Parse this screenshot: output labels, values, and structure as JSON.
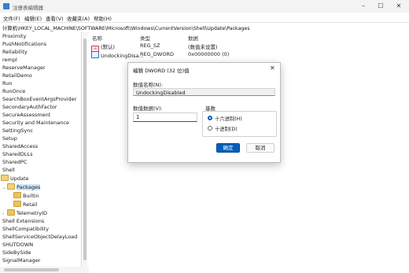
{
  "window": {
    "title": "注册表编辑器",
    "minimize_glyph": "–",
    "maximize_glyph": "☐",
    "close_glyph": "✕"
  },
  "menu": [
    "文件(F)",
    "编辑(E)",
    "查看(V)",
    "收藏夹(A)",
    "帮助(H)"
  ],
  "address": "计算机\\HKEY_LOCAL_MACHINE\\SOFTWARE\\Microsoft\\Windows\\CurrentVersion\\Shell\\Update\\Packages",
  "tree": {
    "items": [
      {
        "label": "Proximity"
      },
      {
        "label": "PushNotifications"
      },
      {
        "label": "Reliability"
      },
      {
        "label": "rempl"
      },
      {
        "label": "ReserveManager"
      },
      {
        "label": "RetailDemo"
      },
      {
        "label": "Run"
      },
      {
        "label": "RunOnce"
      },
      {
        "label": "SearchBoxEventArgsProvider"
      },
      {
        "label": "SecondaryAuthFactor"
      },
      {
        "label": "SecureAssessment"
      },
      {
        "label": "Security and Maintenance"
      },
      {
        "label": "SettingSync"
      },
      {
        "label": "Setup"
      },
      {
        "label": "SharedAccess"
      },
      {
        "label": "SharedDLLs"
      },
      {
        "label": "SharedPC"
      },
      {
        "label": "Shell"
      },
      {
        "label": "Update"
      },
      {
        "label": "Packages"
      },
      {
        "label": "Builtin"
      },
      {
        "label": "Retail"
      },
      {
        "label": "TelemetryID"
      },
      {
        "label": "Shell Extensions"
      },
      {
        "label": "ShellCompatibility"
      },
      {
        "label": "ShellServiceObjectDelayLoad"
      },
      {
        "label": "SHUTDOWN"
      },
      {
        "label": "SideBySide"
      },
      {
        "label": "SignalManager"
      }
    ]
  },
  "values_pane": {
    "columns": {
      "name": "名称",
      "type": "类型",
      "data": "数据"
    },
    "rows": [
      {
        "name": "(默认)",
        "type": "REG_SZ",
        "data": "(数值未设置)",
        "icon": "string-value-icon"
      },
      {
        "name": "UndockingDisa...",
        "type": "REG_DWORD",
        "data": "0x00000000 (0)",
        "icon": "binary-value-icon"
      }
    ]
  },
  "dialog": {
    "title": "编辑 DWORD (32 位)值",
    "close_glyph": "✕",
    "name_label": "数值名称(N):",
    "name_value": "UndockingDisabled",
    "data_label": "数值数据(V):",
    "data_value": "1",
    "base_label": "基数",
    "base_options": [
      {
        "label": "十六进制(H)",
        "selected": true
      },
      {
        "label": "十进制(D)",
        "selected": false
      }
    ],
    "ok_label": "确定",
    "cancel_label": "取消",
    "accent": "#005fb8"
  }
}
